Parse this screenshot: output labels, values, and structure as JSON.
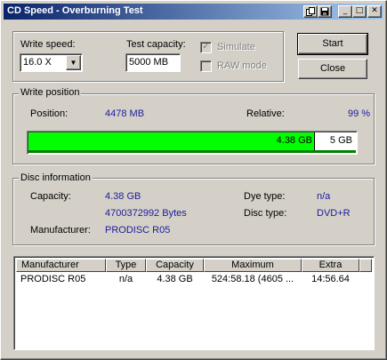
{
  "window": {
    "title": "CD Speed - Overburning Test"
  },
  "title_buttons": {
    "minimize": "_",
    "maximize": "□",
    "close": "✕"
  },
  "settings": {
    "write_speed_label": "Write speed:",
    "write_speed_value": "16.0 X",
    "test_capacity_label": "Test capacity:",
    "test_capacity_value": "5000 MB",
    "simulate_label": "Simulate",
    "simulate_checked": true,
    "raw_mode_label": "RAW mode",
    "raw_mode_checked": false
  },
  "buttons": {
    "start": "Start",
    "close": "Close"
  },
  "write_position": {
    "group_title": "Write position",
    "position_label": "Position:",
    "position_value": "4478 MB",
    "relative_label": "Relative:",
    "relative_value": "99 %",
    "progress_fraction": 0.876,
    "bar_used_label": "4.38 GB",
    "bar_total_label": "5 GB"
  },
  "disc_information": {
    "group_title": "Disc information",
    "capacity_label": "Capacity:",
    "capacity_gb": "4.38 GB",
    "capacity_bytes": "4700372992 Bytes",
    "manufacturer_label": "Manufacturer:",
    "manufacturer_value": "PRODISC R05",
    "dye_type_label": "Dye type:",
    "dye_type_value": "n/a",
    "disc_type_label": "Disc type:",
    "disc_type_value": "DVD+R"
  },
  "results_table": {
    "columns": [
      "Manufacturer",
      "Type",
      "Capacity",
      "Maximum",
      "Extra"
    ],
    "rows": [
      [
        "PRODISC R05",
        "n/a",
        "4.38 GB",
        "524:58.18 (4605 ...",
        "14:56.64"
      ]
    ]
  },
  "colors": {
    "titlebar_start": "#0a246a",
    "titlebar_end": "#a6caf0",
    "progress_fill": "#00ff00",
    "value_text": "#1c1c9c"
  },
  "icons": [
    "save-icon",
    "copy-icon",
    "minimize-icon",
    "maximize-icon",
    "close-icon",
    "dropdown-arrow-icon",
    "check-icon"
  ]
}
